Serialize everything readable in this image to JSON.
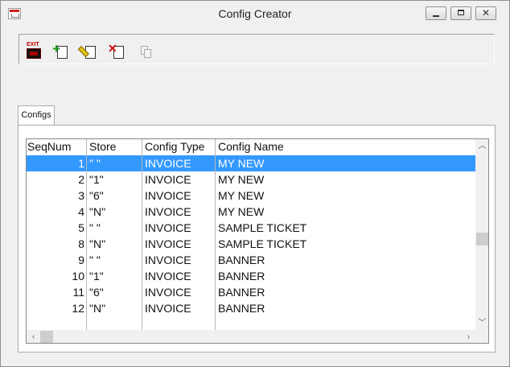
{
  "window": {
    "title": "Config Creator",
    "close_glyph": "✕"
  },
  "toolbar": {
    "exit_label": "EXIT",
    "buttons": [
      "exit-icon",
      "add-icon",
      "edit-icon",
      "delete-icon",
      "copy-icon"
    ]
  },
  "tab": {
    "label": "Configs"
  },
  "grid": {
    "columns": [
      "SeqNum",
      "Store",
      "Config Type",
      "Config Name"
    ],
    "rows": [
      {
        "seq": "1",
        "store": "\" \"",
        "type": "INVOICE",
        "name": "MY NEW",
        "selected": true
      },
      {
        "seq": "2",
        "store": "\"1\"",
        "type": "INVOICE",
        "name": "MY NEW"
      },
      {
        "seq": "3",
        "store": "\"6\"",
        "type": "INVOICE",
        "name": "MY NEW"
      },
      {
        "seq": "4",
        "store": "\"N\"",
        "type": "INVOICE",
        "name": "MY NEW"
      },
      {
        "seq": "5",
        "store": "\" \"",
        "type": "INVOICE",
        "name": "SAMPLE TICKET"
      },
      {
        "seq": "8",
        "store": "\"N\"",
        "type": "INVOICE",
        "name": "SAMPLE TICKET"
      },
      {
        "seq": "9",
        "store": "\" \"",
        "type": "INVOICE",
        "name": "BANNER"
      },
      {
        "seq": "10",
        "store": "\"1\"",
        "type": "INVOICE",
        "name": "BANNER"
      },
      {
        "seq": "11",
        "store": "\"6\"",
        "type": "INVOICE",
        "name": "BANNER"
      },
      {
        "seq": "12",
        "store": "\"N\"",
        "type": "INVOICE",
        "name": "BANNER"
      }
    ]
  },
  "colors": {
    "selection": "#3399ff",
    "exit_red": "#b00000",
    "add_green": "#1f9b1f",
    "delete_red": "#d01010"
  }
}
